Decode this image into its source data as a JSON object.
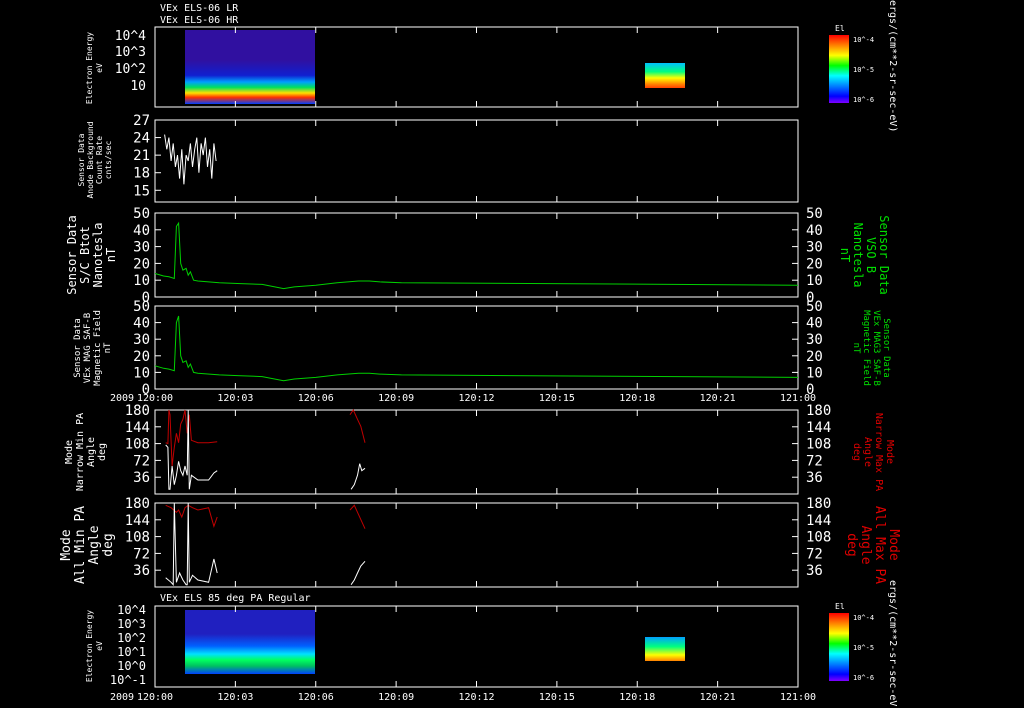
{
  "colors": {
    "background": "#000000",
    "axes": "#ffffff",
    "b_field_trace": "#00d000",
    "right_label_green": "#00e000",
    "max_pa_trace": "#c00000",
    "right_label_red": "#e00000",
    "min_pa_trace": "#ffffff"
  },
  "chart_data": [
    {
      "type": "heatmap",
      "id": "els_lr",
      "titles": [
        "VEx ELS-06 LR",
        "VEx ELS-06 HR"
      ],
      "ylabel": [
        "Electron Energy",
        "eV"
      ],
      "y_scale": "log",
      "y_tick_labels": [
        "10^4",
        "10^3",
        "10^2",
        "10"
      ],
      "colorbar": {
        "title": "El",
        "tick_labels": [
          "10^-4",
          "10^-5",
          "10^-6"
        ],
        "units": "ergs/(cm**2-sr-sec-eV)",
        "colormap": [
          "#ff0000",
          "#ff8000",
          "#ffff00",
          "#00ff00",
          "#00ffff",
          "#0080ff",
          "#0000ff",
          "#8000ff"
        ]
      },
      "data_blocks": [
        {
          "t_start": "120:00.8",
          "t_end": "120:05.8"
        },
        {
          "t_start": "120:18.1",
          "t_end": "120:19.7"
        }
      ]
    },
    {
      "type": "line",
      "id": "anode_bg",
      "ylabel": [
        "Sensor Data",
        "Anode Background",
        "Count Rate",
        "cnts/sec"
      ],
      "ylim": [
        13,
        27
      ],
      "y_ticks": [
        15,
        18,
        21,
        24,
        27
      ],
      "series": [
        {
          "color": "#ffffff",
          "x": [
            "120:00.9",
            "120:01.1",
            "120:01.3",
            "120:01.5",
            "120:01.7",
            "120:01.9",
            "120:02.1",
            "120:02.3",
            "120:02.5",
            "120:02.7",
            "120:02.9",
            "120:03.1",
            "120:03.3",
            "120:03.5",
            "120:03.7",
            "120:03.9",
            "120:04.1",
            "120:04.3",
            "120:04.5",
            "120:04.7",
            "120:04.9",
            "120:05.1",
            "120:05.3",
            "120:05.5",
            "120:05.7"
          ],
          "y": [
            24.5,
            22,
            24,
            20,
            23,
            19,
            21,
            17,
            22,
            16,
            21,
            20,
            23,
            19,
            22,
            24,
            18,
            23,
            21,
            24,
            19,
            22,
            17,
            23,
            20
          ]
        }
      ]
    },
    {
      "type": "line",
      "id": "sc_bmag",
      "ylabel": [
        "Sensor Data",
        "S/C Btot",
        "Nanotesla",
        "nT"
      ],
      "ylabel_right": [
        "Sensor Data",
        "VSO B",
        "Nanotesla",
        "nT"
      ],
      "ylim": [
        0,
        50
      ],
      "y_ticks": [
        0,
        10,
        20,
        30,
        40,
        50
      ],
      "series": [
        {
          "color": "#00d000",
          "x": [
            "120:00.0",
            "120:00.8",
            "120:01.3",
            "120:01.8",
            "120:02.0",
            "120:02.2",
            "120:02.4",
            "120:02.6",
            "120:02.9",
            "120:03.1",
            "120:03.3",
            "120:03.6",
            "120:04.0",
            "120:06.0",
            "120:08.0",
            "120:10.0",
            "120:12.0",
            "120:13.0",
            "120:15.0",
            "120:17.0",
            "120:19.0",
            "120:20.0",
            "120:21.0",
            "120:23.0",
            "121:00.0"
          ],
          "y": [
            14,
            12.5,
            12,
            11,
            42,
            44,
            20,
            16,
            17,
            13,
            15,
            10,
            9.5,
            8.5,
            8,
            7.5,
            5,
            6,
            7,
            8.5,
            9.5,
            9.5,
            9,
            8.5,
            7
          ]
        }
      ]
    },
    {
      "type": "line",
      "id": "mag3_saf",
      "ylabel": [
        "Sensor Data",
        "VEx MAG SAF-B",
        "Magnetic Field",
        "nT"
      ],
      "ylabel_right": [
        "Sensor Data",
        "VEx MAG3 SAF-B",
        "Magnetic Field",
        "nT"
      ],
      "ylim": [
        0,
        50
      ],
      "y_ticks": [
        0,
        10,
        20,
        30,
        40,
        50
      ],
      "series": [
        {
          "color": "#00d000",
          "x": [
            "120:00.0",
            "120:00.8",
            "120:01.3",
            "120:01.8",
            "120:02.0",
            "120:02.2",
            "120:02.4",
            "120:02.6",
            "120:02.9",
            "120:03.1",
            "120:03.3",
            "120:03.6",
            "120:04.0",
            "120:06.0",
            "120:08.0",
            "120:10.0",
            "120:12.0",
            "120:13.0",
            "120:15.0",
            "120:17.0",
            "120:19.0",
            "120:20.0",
            "120:21.0",
            "120:23.0",
            "121:00.0"
          ],
          "y": [
            14,
            12.5,
            12,
            11,
            40,
            44,
            20,
            16,
            17,
            13,
            15,
            10,
            9.5,
            8.5,
            8,
            7.5,
            5,
            6,
            7,
            8.5,
            9.5,
            9.5,
            9,
            8.5,
            7
          ]
        }
      ]
    },
    {
      "type": "line",
      "id": "narrow_pa",
      "ylabel": [
        "Mode",
        "Narrow Min PA",
        "Angle",
        "deg"
      ],
      "ylabel_right": [
        "Mode",
        "Narrow Max PA",
        "Angle",
        "deg"
      ],
      "ylim": [
        0,
        180
      ],
      "y_ticks": [
        36,
        72,
        108,
        144,
        180
      ],
      "series": [
        {
          "color": "#c00000",
          "x": [
            "120:01.0",
            "120:01.2",
            "120:01.3",
            "120:01.4",
            "120:01.6",
            "120:01.8",
            "120:02.0",
            "120:02.2",
            "120:02.4",
            "120:02.6",
            "120:02.8",
            "120:03.0",
            "120:03.2",
            "120:03.4",
            "120:04.0",
            "120:05.0",
            "120:05.8"
          ],
          "y": [
            110,
            108,
            180,
            170,
            60,
            100,
            130,
            110,
            150,
            160,
            180,
            130,
            170,
            115,
            110,
            110,
            112
          ]
        },
        {
          "color": "#c00000",
          "x": [
            "120:18.2",
            "120:18.5",
            "120:18.9",
            "120:19.2",
            "120:19.6"
          ],
          "y": [
            170,
            180,
            160,
            145,
            110
          ]
        },
        {
          "color": "#ffffff",
          "x": [
            "120:01.0",
            "120:01.2",
            "120:01.3",
            "120:01.4",
            "120:01.6",
            "120:01.8",
            "120:02.0",
            "120:02.2",
            "120:02.4",
            "120:02.6",
            "120:02.8",
            "120:03.0",
            "120:03.1",
            "120:03.2",
            "120:03.4",
            "120:04.0",
            "120:05.0",
            "120:05.5",
            "120:05.8"
          ],
          "y": [
            105,
            100,
            10,
            10,
            60,
            20,
            40,
            70,
            50,
            40,
            60,
            40,
            180,
            10,
            40,
            30,
            30,
            45,
            50
          ]
        },
        {
          "color": "#ffffff",
          "x": [
            "120:18.3",
            "120:18.6",
            "120:18.9",
            "120:19.1",
            "120:19.3",
            "120:19.6"
          ],
          "y": [
            10,
            20,
            40,
            65,
            50,
            55
          ]
        }
      ]
    },
    {
      "type": "line",
      "id": "all_pa",
      "ylabel": [
        "Mode",
        "All Min PA",
        "Angle",
        "deg"
      ],
      "ylabel_right": [
        "Mode",
        "All Max PA",
        "Angle",
        "deg"
      ],
      "ylim": [
        0,
        180
      ],
      "y_ticks": [
        36,
        72,
        108,
        144,
        180
      ],
      "series": [
        {
          "color": "#c00000",
          "x": [
            "120:01.0",
            "120:01.5",
            "120:02.0",
            "120:02.2",
            "120:02.5",
            "120:02.8",
            "120:03.1",
            "120:03.5",
            "120:04.0",
            "120:05.0",
            "120:05.5",
            "120:05.8"
          ],
          "y": [
            175,
            170,
            160,
            165,
            150,
            170,
            175,
            170,
            165,
            170,
            130,
            150
          ]
        },
        {
          "color": "#c00000",
          "x": [
            "120:18.2",
            "120:18.6",
            "120:19.0",
            "120:19.3",
            "120:19.6"
          ],
          "y": [
            165,
            175,
            155,
            140,
            125
          ]
        },
        {
          "color": "#ffffff",
          "x": [
            "120:01.0",
            "120:01.5",
            "120:01.7",
            "120:01.8",
            "120:02.0",
            "120:02.3",
            "120:02.6",
            "120:02.9",
            "120:03.0",
            "120:03.1",
            "120:03.2",
            "120:03.5",
            "120:04.0",
            "120:05.0",
            "120:05.5",
            "120:05.8"
          ],
          "y": [
            20,
            10,
            5,
            180,
            10,
            30,
            15,
            5,
            5,
            180,
            10,
            25,
            15,
            10,
            60,
            30
          ]
        },
        {
          "color": "#ffffff",
          "x": [
            "120:18.3",
            "120:18.6",
            "120:18.9",
            "120:19.2",
            "120:19.6"
          ],
          "y": [
            5,
            15,
            30,
            45,
            55
          ]
        }
      ]
    },
    {
      "type": "heatmap",
      "id": "els_85deg",
      "titles": [
        "VEx ELS 85 deg PA Regular"
      ],
      "ylabel": [
        "Electron Energy",
        "eV"
      ],
      "y_scale": "log",
      "y_tick_labels": [
        "10^4",
        "10^3",
        "10^2",
        "10^1",
        "10^0",
        "10^-1"
      ],
      "colorbar": {
        "title": "El",
        "tick_labels": [
          "10^-4",
          "10^-5",
          "10^-6"
        ],
        "units": "ergs/(cm**2-sr-sec-eV)",
        "colormap": [
          "#ff0000",
          "#ff8000",
          "#ffff00",
          "#00ff00",
          "#00ffff",
          "#0080ff",
          "#0000ff",
          "#8000ff"
        ]
      },
      "data_blocks": [
        {
          "t_start": "120:00.8",
          "t_end": "120:05.8"
        },
        {
          "t_start": "120:18.1",
          "t_end": "120:19.7"
        }
      ]
    }
  ],
  "x_axis": {
    "year_label": "2009",
    "tick_labels": [
      "120:00",
      "120:03",
      "120:06",
      "120:09",
      "120:12",
      "120:15",
      "120:18",
      "120:21",
      "121:00"
    ]
  }
}
